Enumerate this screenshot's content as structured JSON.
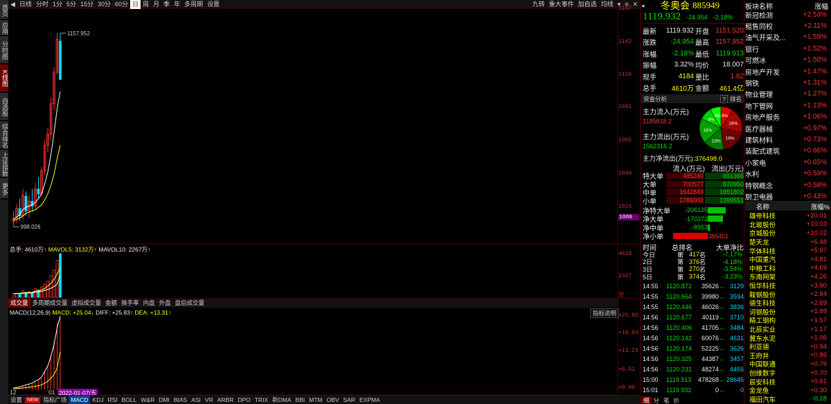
{
  "sidebar": [
    {
      "label": "首页"
    },
    {
      "label": "应用"
    },
    {
      "label": "分时图"
    },
    {
      "label": "K线图",
      "active": true
    },
    {
      "label": "自选股"
    },
    {
      "label": "综合排名"
    },
    {
      "label": "上证指数"
    },
    {
      "label": "更多"
    }
  ],
  "period_tabs": [
    "日线",
    "分时",
    "1分",
    "5分",
    "15分",
    "30分",
    "60分",
    "日",
    "周",
    "月",
    "季",
    "年",
    "多周期",
    "设置"
  ],
  "period_active": "日",
  "toolbar_right": [
    "九转",
    "重大事件",
    "加自选",
    "均线"
  ],
  "price_axis": [
    "1167",
    "1142",
    "1116",
    "1091",
    "1065",
    "1040",
    "1015",
    "1006"
  ],
  "price_axis_highlight": "1006",
  "max_label": "1157.952",
  "min_label": "998.026",
  "vol_info": {
    "total": "总手: 4610万↑",
    "mav5": "MAVOL5: 3132万↑",
    "mav10": "MAVOL10: 2267万↑"
  },
  "vol_axis": [
    "4610",
    "2327",
    "万"
  ],
  "vol_tabs": [
    "成交量",
    "多周期成交量",
    "虚拟成交量",
    "金额",
    "换手率",
    "内盘",
    "外盘",
    "盘后成交量"
  ],
  "macd_info": {
    "label": "MACD(12,26,9)",
    "macd": "MACD: +25.04↓",
    "diff": "DIFF: +25.83↑",
    "dea": "DEA: +13.31↑"
  },
  "macd_button": "指标说明",
  "macd_axis": [
    "+25.83",
    "+19.84",
    "+13.23",
    "+6.61",
    "+0.00"
  ],
  "x_axis": {
    "left": "12",
    "mid": "01",
    "date": "2022-01-07/五"
  },
  "bottom_tabs": [
    "设置",
    "NEW",
    "指标广场",
    "MACD",
    "KDJ",
    "RSI",
    "BOLL",
    "W&R",
    "DMI",
    "BIAS",
    "ASI",
    "VR",
    "ARBR",
    "DPO",
    "TRIX",
    "新DMA",
    "BBI",
    "MTM",
    "OBV",
    "SAR",
    "EXPMA"
  ],
  "bottom_active": "MACD",
  "stock": {
    "name": "冬奥会",
    "code": "885949",
    "price": "1119.932",
    "change": "-24.954",
    "pct": "-2.18%"
  },
  "quote": [
    {
      "l1": "最新",
      "v1": "1119.932",
      "c1": "white",
      "l2": "开盘",
      "v2": "1151.520",
      "c2": "red"
    },
    {
      "l1": "涨跌",
      "v1": "-24.954",
      "c1": "green",
      "l2": "最高",
      "v2": "1157.952",
      "c2": "red"
    },
    {
      "l1": "涨幅",
      "v1": "-2.18%",
      "c1": "green",
      "l2": "最低",
      "v2": "1119.913",
      "c2": "green"
    },
    {
      "l1": "振幅",
      "v1": "3.32%",
      "c1": "white",
      "l2": "均价",
      "v2": "18.007",
      "c2": "white"
    },
    {
      "l1": "现手",
      "v1": "4184",
      "c1": "yellow",
      "l2": "量比",
      "v2": "1.82",
      "c2": "red"
    },
    {
      "l1": "总手",
      "v1": "4610万",
      "c1": "yellow",
      "l2": "金额",
      "v2": "461.4亿",
      "c2": "yellow"
    }
  ],
  "fund": {
    "title": "资金分析",
    "help": "?",
    "rank": "排名",
    "in_label": "主力流入(万元)",
    "in_val": "1185818.2",
    "out_label": "主力流出(万元)",
    "out_val": "1562316.2",
    "net_label": "主力净流出(万元):",
    "net_val": "376498.0",
    "pie": [
      {
        "label": "9%",
        "value": 9,
        "color": "#e00000"
      },
      {
        "label": "18%",
        "value": 18,
        "color": "#a80000"
      },
      {
        "label": "19%",
        "value": 19,
        "color": "#6a0000"
      },
      {
        "label": "15%",
        "value": 15,
        "color": "#007a00"
      },
      {
        "label": "18%",
        "value": 18,
        "color": "#00a000"
      },
      {
        "label": "9%",
        "value": 9,
        "color": "#00d000"
      },
      {
        "label": "8%",
        "value": 8,
        "color": "#00ff00"
      }
    ]
  },
  "flow_header": {
    "in": "流入(万元)",
    "out": "流出(万元)"
  },
  "flow": [
    {
      "label": "特大单",
      "in": "485240",
      "out": "691366"
    },
    {
      "label": "大单",
      "in": "700577",
      "out": "870950"
    },
    {
      "label": "中单",
      "in": "1642849",
      "out": "1651802"
    },
    {
      "label": "小单",
      "in": "1786002",
      "out": "1399551"
    }
  ],
  "net": [
    {
      "label": "净特大单",
      "val": "-206125",
      "color": "green"
    },
    {
      "label": "净大单",
      "val": "-170372",
      "color": "green"
    },
    {
      "label": "净中单",
      "val": "-8953",
      "color": "green"
    },
    {
      "label": "净小单",
      "val": "385451",
      "color": "red"
    }
  ],
  "rank_header": {
    "time": "时间",
    "rank": "总排名",
    "net": "大单净比"
  },
  "rank": [
    {
      "d": "今日",
      "p": "第",
      "r": "417",
      "s": "名",
      "v": "-7.17%"
    },
    {
      "d": "2日",
      "p": "第",
      "r": "376",
      "s": "名",
      "v": "-4.18%"
    },
    {
      "d": "3日",
      "p": "第",
      "r": "270",
      "s": "名",
      "v": "-3.54%"
    },
    {
      "d": "5日",
      "p": "第",
      "r": "374",
      "s": "名",
      "v": "-3.23%"
    }
  ],
  "ticks": [
    {
      "t": "14:55",
      "p": "1120.872",
      "v": "35626",
      "n": "3129"
    },
    {
      "t": "14:55",
      "p": "1120.664",
      "v": "39980",
      "n": "3594"
    },
    {
      "t": "14:55",
      "p": "1120.446",
      "v": "46026",
      "n": "3836"
    },
    {
      "t": "14:56",
      "p": "1120.677",
      "v": "40119",
      "n": "3710"
    },
    {
      "t": "14:56",
      "p": "1120.406",
      "v": "41705",
      "n": "3484"
    },
    {
      "t": "14:56",
      "p": "1120.142",
      "v": "60076",
      "n": "4631"
    },
    {
      "t": "14:56",
      "p": "1120.174",
      "v": "52225",
      "n": "3626"
    },
    {
      "t": "14:56",
      "p": "1120.325",
      "v": "44387",
      "n": "3457"
    },
    {
      "t": "14:56",
      "p": "1120.231",
      "v": "48274",
      "n": "4455"
    },
    {
      "t": "15:00",
      "p": "1119.913",
      "v": "478268",
      "n": "28645"
    },
    {
      "t": "15:01",
      "p": "1119.932",
      "v": "0",
      "n": "0"
    }
  ],
  "tick_tabs": [
    "细",
    "分",
    "笔",
    "价"
  ],
  "sector_header": {
    "name": "板块名称",
    "pct": "涨幅"
  },
  "sectors": [
    {
      "n": "新冠检测",
      "v": "+2.53%"
    },
    {
      "n": "租售同权",
      "v": "+2.11%"
    },
    {
      "n": "油气开采及...",
      "v": "+1.59%"
    },
    {
      "n": "银行",
      "v": "+1.52%"
    },
    {
      "n": "可燃冰",
      "v": "+1.50%"
    },
    {
      "n": "房地产开发",
      "v": "+1.47%"
    },
    {
      "n": "钢铁",
      "v": "+1.31%"
    },
    {
      "n": "物业管理",
      "v": "+1.27%"
    },
    {
      "n": "地下管网",
      "v": "+1.13%"
    },
    {
      "n": "房地产服务",
      "v": "+1.06%"
    },
    {
      "n": "医疗器械",
      "v": "+0.97%"
    },
    {
      "n": "建筑材料",
      "v": "+0.73%"
    },
    {
      "n": "装配式建筑",
      "v": "+0.66%"
    },
    {
      "n": "小家电",
      "v": "+0.65%"
    },
    {
      "n": "水利",
      "v": "+0.59%"
    },
    {
      "n": "特钢概念",
      "v": "+0.58%"
    },
    {
      "n": "厨卫电器",
      "v": "+0.43%"
    }
  ],
  "stock_list_header": {
    "name": "名称",
    "pct": "涨幅%"
  },
  "stock_list": [
    {
      "n": "雄帝科技",
      "v": "+20.01"
    },
    {
      "n": "北玻股份",
      "v": "+10.03"
    },
    {
      "n": "京城股份",
      "v": "+10.02"
    },
    {
      "n": "楚天龙",
      "v": "+6.48"
    },
    {
      "n": "华体科技",
      "v": "+5.97"
    },
    {
      "n": "中国重汽",
      "v": "+4.81"
    },
    {
      "n": "中粮工科",
      "v": "+4.69"
    },
    {
      "n": "东南网架",
      "v": "+4.26"
    },
    {
      "n": "恒华科技",
      "v": "+3.80"
    },
    {
      "n": "鞍钢股份",
      "v": "+2.84"
    },
    {
      "n": "德生科技",
      "v": "+2.69"
    },
    {
      "n": "诃钢股份",
      "v": "+1.99"
    },
    {
      "n": "精工钢构",
      "v": "+1.57"
    },
    {
      "n": "北辰实业",
      "v": "+1.17"
    },
    {
      "n": "冀东水泥",
      "v": "+1.06"
    },
    {
      "n": "利亚德",
      "v": "+0.94"
    },
    {
      "n": "王府井",
      "v": "+0.86"
    },
    {
      "n": "中国联通",
      "v": "+0.76"
    },
    {
      "n": "创维数字",
      "v": "+0.70"
    },
    {
      "n": "辰安科技",
      "v": "+0.61"
    },
    {
      "n": "金龙鱼",
      "v": "+0.30"
    },
    {
      "n": "福田汽车",
      "v": "-0.28"
    }
  ],
  "chart_data": {
    "type": "candlestick",
    "ylim": [
      998,
      1167
    ],
    "candles": [
      {
        "o": 1003,
        "h": 1012,
        "l": 999,
        "c": 1006
      },
      {
        "o": 1006,
        "h": 1018,
        "l": 1002,
        "c": 1014
      },
      {
        "o": 1014,
        "h": 1022,
        "l": 1004,
        "c": 1008
      },
      {
        "o": 1008,
        "h": 1030,
        "l": 1005,
        "c": 1025
      },
      {
        "o": 1024,
        "h": 1028,
        "l": 1008,
        "c": 1012
      },
      {
        "o": 1012,
        "h": 1025,
        "l": 1006,
        "c": 1020
      },
      {
        "o": 1020,
        "h": 1030,
        "l": 1012,
        "c": 1016
      },
      {
        "o": 1016,
        "h": 1035,
        "l": 1014,
        "c": 1030
      },
      {
        "o": 1030,
        "h": 1040,
        "l": 1022,
        "c": 1026
      },
      {
        "o": 1026,
        "h": 1048,
        "l": 1024,
        "c": 1045
      },
      {
        "o": 1045,
        "h": 1070,
        "l": 1042,
        "c": 1066
      },
      {
        "o": 1066,
        "h": 1080,
        "l": 1060,
        "c": 1075
      },
      {
        "o": 1075,
        "h": 1105,
        "l": 1070,
        "c": 1100
      },
      {
        "o": 1100,
        "h": 1130,
        "l": 1095,
        "c": 1126
      },
      {
        "o": 1126,
        "h": 1158,
        "l": 1124,
        "c": 1153
      },
      {
        "o": 1151.5,
        "h": 1157.952,
        "l": 1119.913,
        "c": 1119.932
      }
    ],
    "ma5": [
      1005,
      1007,
      1009,
      1013,
      1015,
      1016,
      1017,
      1019,
      1022,
      1026,
      1034,
      1044,
      1058,
      1076,
      1096,
      1110
    ],
    "ma10": [
      1004,
      1005,
      1006,
      1008,
      1010,
      1011,
      1012,
      1013,
      1015,
      1017,
      1021,
      1026,
      1033,
      1042,
      1055,
      1066
    ],
    "volume": [
      380,
      420,
      360,
      720,
      520,
      560,
      480,
      900,
      780,
      1100,
      1400,
      1700,
      2300,
      2900,
      3900,
      4610
    ],
    "mavol5": [
      400,
      410,
      420,
      470,
      480,
      520,
      530,
      650,
      650,
      760,
      930,
      1200,
      1460,
      1900,
      2460,
      3132
    ],
    "mavol10": [
      380,
      390,
      400,
      420,
      440,
      460,
      480,
      540,
      560,
      620,
      720,
      820,
      960,
      1140,
      1400,
      2267
    ],
    "macd_hist": [
      0.6,
      0.8,
      0.9,
      1.4,
      1.5,
      1.8,
      1.9,
      2.6,
      2.9,
      4.0,
      6.2,
      8.3,
      12.0,
      17.0,
      23.5,
      25.04
    ],
    "diff": [
      0.5,
      0.7,
      0.9,
      1.3,
      1.6,
      1.9,
      2.2,
      2.9,
      3.4,
      4.4,
      6.3,
      8.3,
      11.6,
      15.8,
      21.6,
      25.83
    ],
    "dea": [
      0.2,
      0.3,
      0.4,
      0.5,
      0.6,
      0.8,
      0.9,
      1.1,
      1.3,
      1.6,
      2.2,
      2.9,
      3.9,
      5.3,
      7.5,
      13.31
    ],
    "macd_ylim": [
      0,
      25.83
    ],
    "vol_ylim": [
      0,
      4610
    ]
  }
}
